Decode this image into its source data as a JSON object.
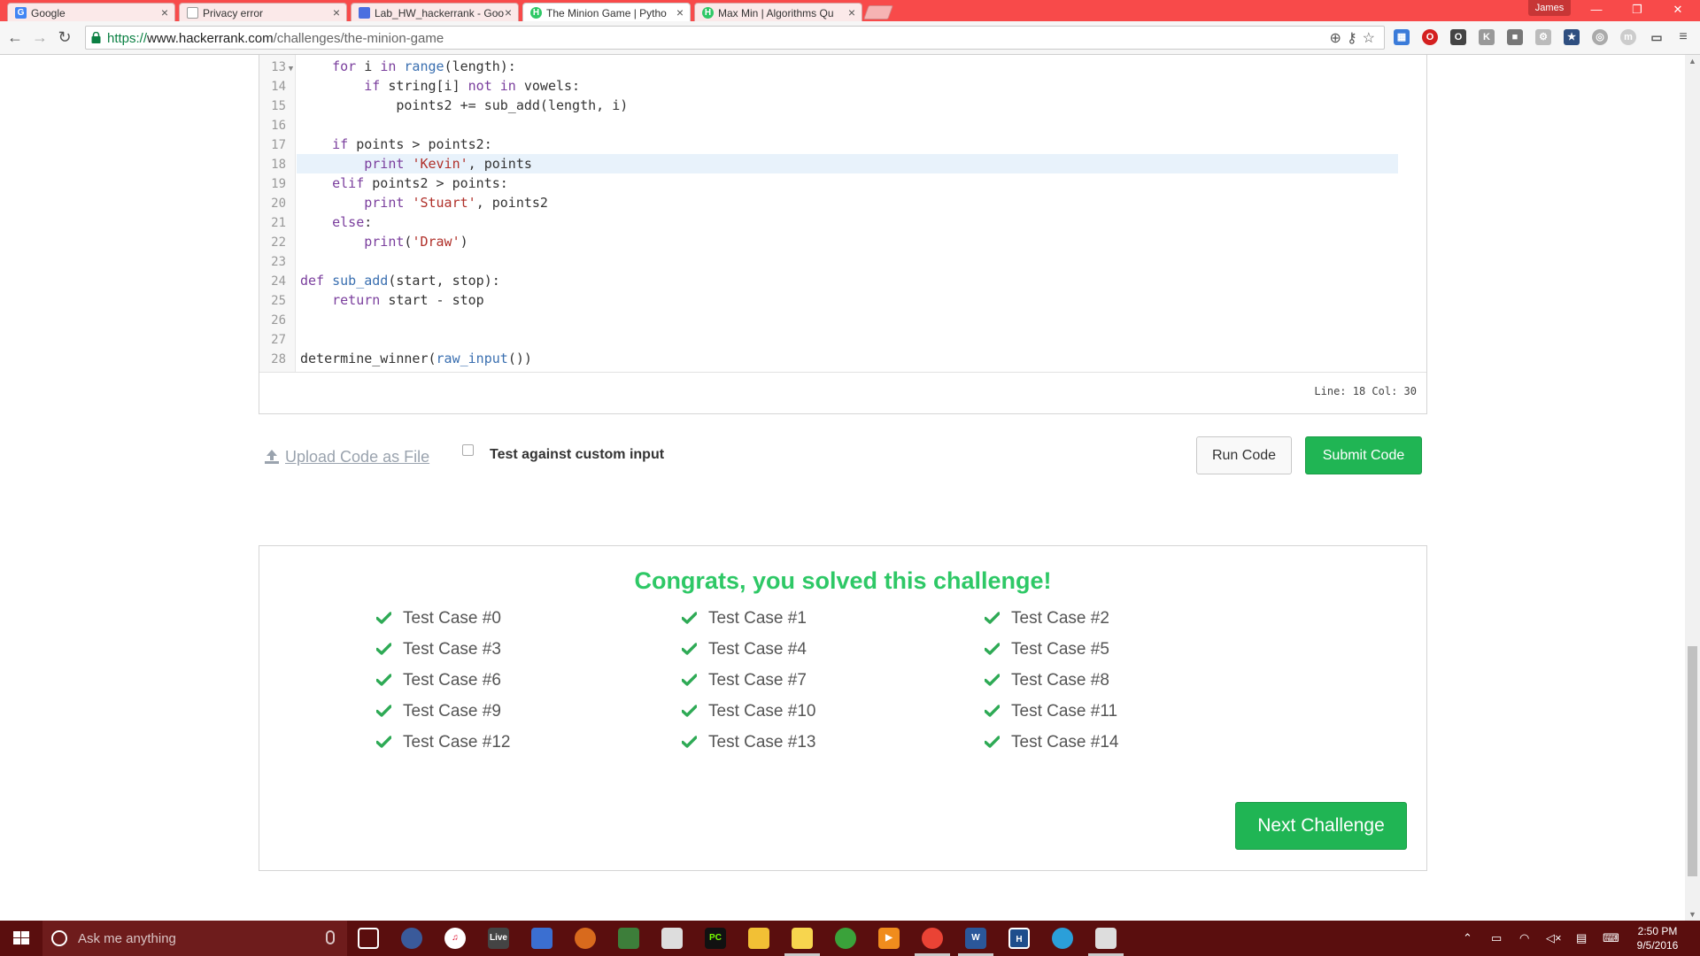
{
  "browser": {
    "tabs": [
      {
        "title": "Google",
        "favicon": "G",
        "color": "#4285f4"
      },
      {
        "title": "Privacy error",
        "favicon": "doc",
        "color": "#888888"
      },
      {
        "title": "Lab_HW_hackerrank - Goo",
        "favicon": "doc",
        "color": "#4a6ee0"
      },
      {
        "title": "The Minion Game | Pytho",
        "favicon": "H",
        "color": "#2ec866"
      },
      {
        "title": "Max Min | Algorithms Qu",
        "favicon": "H",
        "color": "#2ec866"
      }
    ],
    "profile_name": "James",
    "url": {
      "scheme": "https://",
      "host": "www.hackerrank.com",
      "path": "/challenges/the-minion-game"
    }
  },
  "editor": {
    "lines": [
      {
        "n": "13",
        "fold": true,
        "tokens": [
          [
            "",
            "    "
          ],
          [
            "kw",
            "for"
          ],
          [
            "",
            " i "
          ],
          [
            "kw",
            "in"
          ],
          [
            "",
            " "
          ],
          [
            "bi",
            "range"
          ],
          [
            "",
            "(length):"
          ]
        ]
      },
      {
        "n": "14",
        "tokens": [
          [
            "",
            "        "
          ],
          [
            "kw",
            "if"
          ],
          [
            "",
            " string[i] "
          ],
          [
            "kw",
            "not in"
          ],
          [
            "",
            " vowels:"
          ]
        ]
      },
      {
        "n": "15",
        "tokens": [
          [
            "",
            "            points2 += sub_add(length, i)"
          ]
        ]
      },
      {
        "n": "16",
        "tokens": []
      },
      {
        "n": "17",
        "tokens": [
          [
            "",
            "    "
          ],
          [
            "kw",
            "if"
          ],
          [
            "",
            " points > points2:"
          ]
        ]
      },
      {
        "n": "18",
        "highlight": true,
        "tokens": [
          [
            "",
            "        "
          ],
          [
            "kw",
            "print"
          ],
          [
            "",
            " "
          ],
          [
            "str",
            "'Kevin'"
          ],
          [
            "",
            ", points"
          ]
        ]
      },
      {
        "n": "19",
        "tokens": [
          [
            "",
            "    "
          ],
          [
            "kw",
            "elif"
          ],
          [
            "",
            " points2 > points:"
          ]
        ]
      },
      {
        "n": "20",
        "tokens": [
          [
            "",
            "        "
          ],
          [
            "kw",
            "print"
          ],
          [
            "",
            " "
          ],
          [
            "str",
            "'Stuart'"
          ],
          [
            "",
            ", points2"
          ]
        ]
      },
      {
        "n": "21",
        "tokens": [
          [
            "",
            "    "
          ],
          [
            "kw",
            "else"
          ],
          [
            "",
            ":"
          ]
        ]
      },
      {
        "n": "22",
        "tokens": [
          [
            "",
            "        "
          ],
          [
            "kw",
            "print"
          ],
          [
            "",
            "("
          ],
          [
            "str",
            "'Draw'"
          ],
          [
            "",
            ")"
          ]
        ]
      },
      {
        "n": "23",
        "tokens": []
      },
      {
        "n": "24",
        "tokens": [
          [
            "kw",
            "def"
          ],
          [
            "",
            " "
          ],
          [
            "fn",
            "sub_add"
          ],
          [
            "",
            "(start, stop):"
          ]
        ]
      },
      {
        "n": "25",
        "tokens": [
          [
            "",
            "    "
          ],
          [
            "kw",
            "return"
          ],
          [
            "",
            " start - stop"
          ]
        ]
      },
      {
        "n": "26",
        "tokens": []
      },
      {
        "n": "27",
        "tokens": []
      },
      {
        "n": "28",
        "tokens": [
          [
            "",
            "determine_winner("
          ],
          [
            "bi",
            "raw_input"
          ],
          [
            "",
            "())"
          ]
        ]
      }
    ],
    "cursor_status": "Line: 18 Col: 30"
  },
  "actions": {
    "upload_label": "Upload Code as File",
    "custom_input_label": "Test against custom input",
    "custom_input_checked": false,
    "run_label": "Run Code",
    "submit_label": "Submit Code"
  },
  "result": {
    "title": "Congrats, you solved this challenge!",
    "test_cases": [
      "Test Case #0",
      "Test Case #1",
      "Test Case #2",
      "Test Case #3",
      "Test Case #4",
      "Test Case #5",
      "Test Case #6",
      "Test Case #7",
      "Test Case #8",
      "Test Case #9",
      "Test Case #10",
      "Test Case #11",
      "Test Case #12",
      "Test Case #13",
      "Test Case #14"
    ],
    "next_label": "Next Challenge"
  },
  "taskbar": {
    "search_placeholder": "Ask me anything",
    "time": "2:50 PM",
    "date": "9/5/2016"
  },
  "colors": {
    "accent_green": "#20b554",
    "congrats_green": "#2ec866",
    "tab_strip": "#f84a4a",
    "taskbar": "#5a0e0e"
  }
}
